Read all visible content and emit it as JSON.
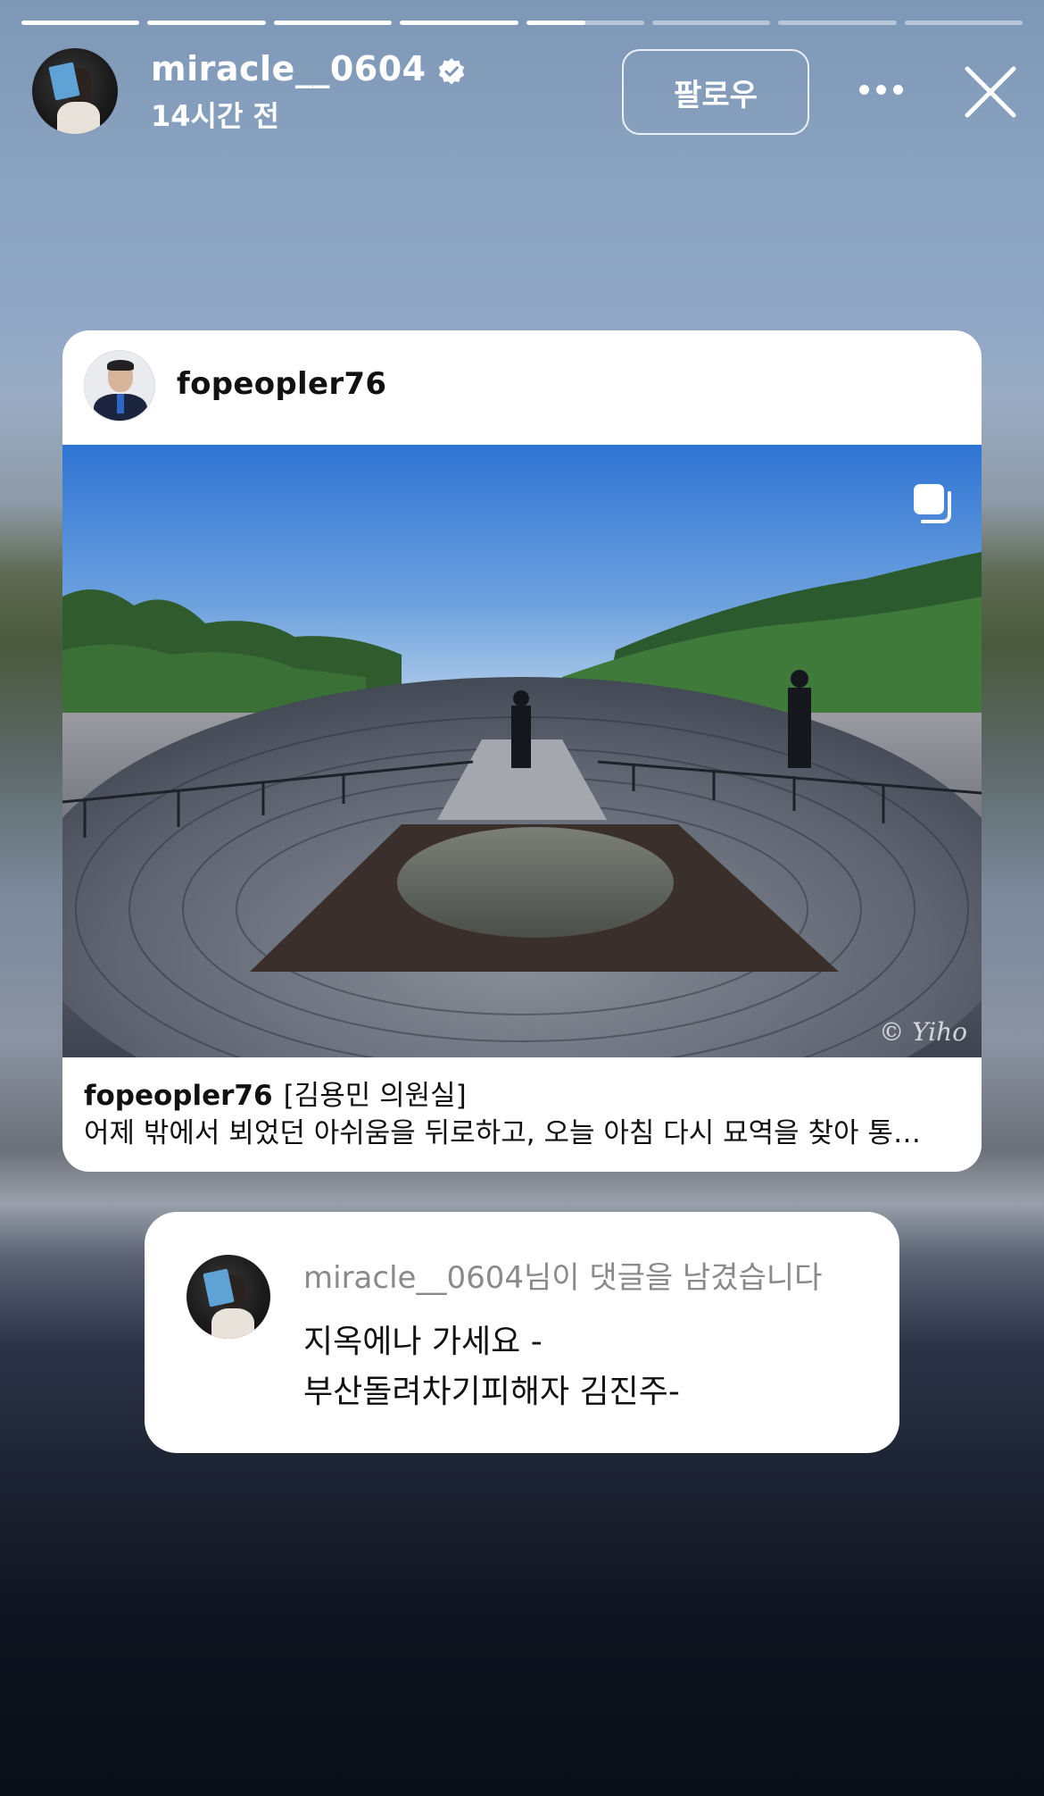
{
  "story": {
    "progress_segments": [
      1,
      1,
      1,
      1,
      0.5,
      0,
      0,
      0
    ]
  },
  "header": {
    "username": "miracle__0604",
    "verified": true,
    "time_ago": "14시간 전",
    "follow_label": "팔로우",
    "more_icon": "more-horizontal-icon",
    "close_icon": "close-icon"
  },
  "post": {
    "author": "fopeopler76",
    "caption_user": "fopeopler76",
    "caption_title": "[김용민 의원실]",
    "caption_text": "어제 밖에서 뵈었던 아쉬움을 뒤로하고, 오늘 아침 다시 묘역을 찾아 통…",
    "watermark": "© Yiho",
    "carousel_icon": "multiple-photos-icon"
  },
  "comment": {
    "notice": "miracle__0604님이 댓글을 남겼습니다",
    "line1": "지옥에나 가세요 -",
    "line2": "부산돌려차기피해자 김진주-"
  }
}
